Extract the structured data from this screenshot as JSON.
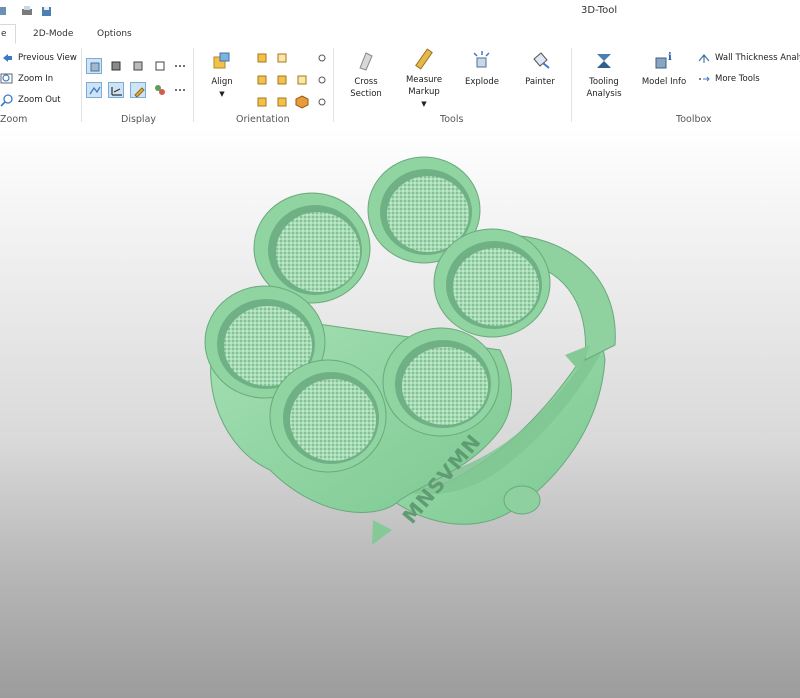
{
  "window": {
    "title": "3D-Tool"
  },
  "tabs": [
    {
      "label": "e"
    },
    {
      "label": "2D-Mode"
    },
    {
      "label": "Options"
    }
  ],
  "zoom_group": {
    "label": "Zoom",
    "items": [
      {
        "label": "Previous View",
        "icon": "back-arrow-icon"
      },
      {
        "label": "Zoom In",
        "icon": "zoom-in-icon"
      },
      {
        "label": "Zoom Out",
        "icon": "zoom-out-icon"
      }
    ]
  },
  "display_group": {
    "label": "Display"
  },
  "orientation_group": {
    "label": "Orientation",
    "align_label": "Align"
  },
  "tools_group": {
    "label": "Tools",
    "cross_section": "Cross\nSection",
    "measure": "Measure\nMarkup",
    "explode": "Explode",
    "painter": "Painter"
  },
  "toolbox_group": {
    "label": "Toolbox",
    "tooling": "Tooling\nAnalysis",
    "model_info": "Model Info",
    "wall_thickness": "Wall Thickness Analys",
    "more_tools": "More Tools"
  },
  "model": {
    "engraving": "MNSVMN",
    "color": "#8fd6a2",
    "shade": "#6dbb84",
    "highlight": "#b6ebc2"
  }
}
